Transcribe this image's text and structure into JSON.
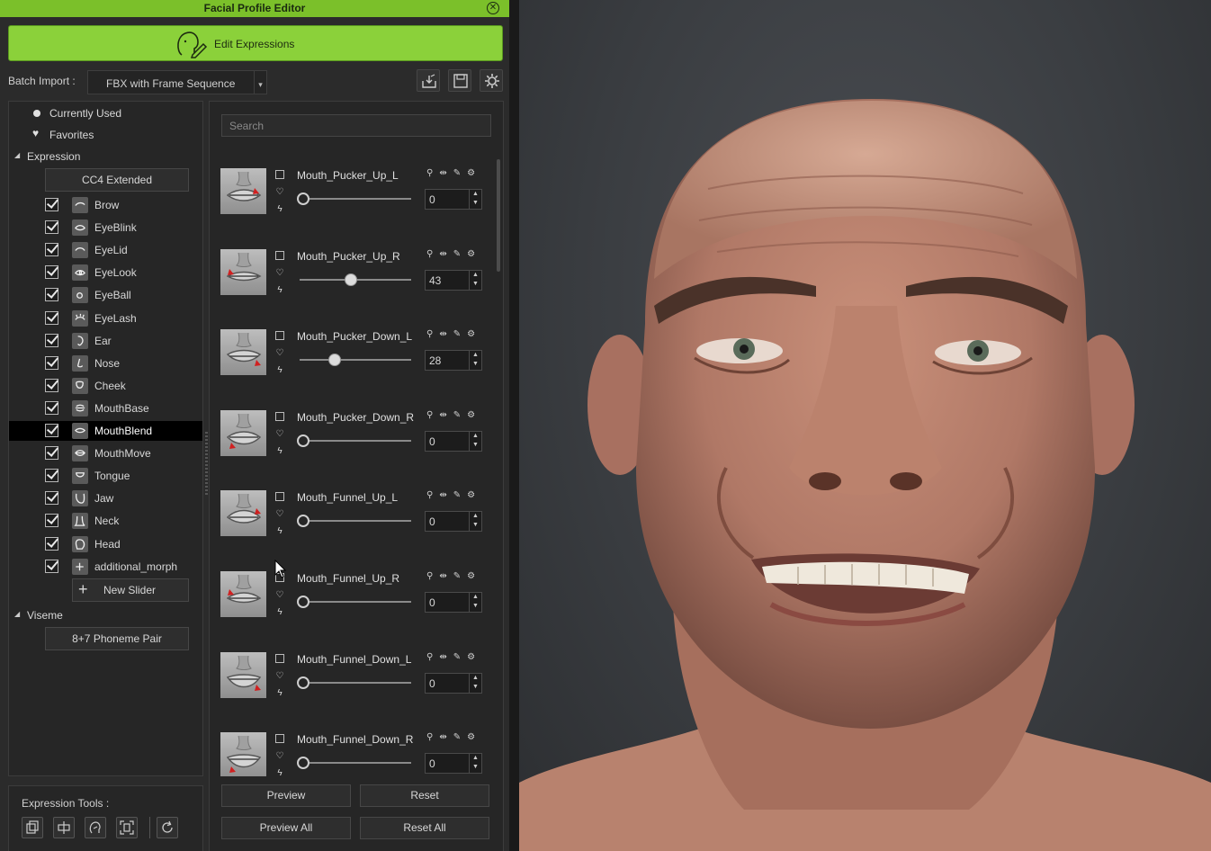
{
  "window": {
    "title": "Facial Profile Editor"
  },
  "edit_expressions": {
    "label": "Edit Expressions"
  },
  "batch_import": {
    "label": "Batch Import :",
    "value": "FBX with Frame Sequence"
  },
  "tree": {
    "currently_used": "Currently Used",
    "favorites": "Favorites",
    "expression_header": "Expression",
    "expression_profile": "CC4 Extended",
    "categories": [
      "Brow",
      "EyeBlink",
      "EyeLid",
      "EyeLook",
      "EyeBall",
      "EyeLash",
      "Ear",
      "Nose",
      "Cheek",
      "MouthBase",
      "MouthBlend",
      "MouthMove",
      "Tongue",
      "Jaw",
      "Neck",
      "Head",
      "additional_morph"
    ],
    "selected_category": "MouthBlend",
    "new_slider": "New Slider",
    "viseme_header": "Viseme",
    "viseme_profile": "8+7 Phoneme Pair"
  },
  "expression_tools": {
    "label": "Expression Tools :"
  },
  "search": {
    "placeholder": "Search"
  },
  "morphs": [
    {
      "name": "Mouth_Pucker_Up_L",
      "value": "0"
    },
    {
      "name": "Mouth_Pucker_Up_R",
      "value": "43"
    },
    {
      "name": "Mouth_Pucker_Down_L",
      "value": "28"
    },
    {
      "name": "Mouth_Pucker_Down_R",
      "value": "0"
    },
    {
      "name": "Mouth_Funnel_Up_L",
      "value": "0"
    },
    {
      "name": "Mouth_Funnel_Up_R",
      "value": "0"
    },
    {
      "name": "Mouth_Funnel_Down_L",
      "value": "0"
    },
    {
      "name": "Mouth_Funnel_Down_R",
      "value": "0"
    }
  ],
  "actions": {
    "preview": "Preview",
    "reset": "Reset",
    "preview_all": "Preview All",
    "reset_all": "Reset All"
  },
  "colors": {
    "accent": "#8bd13a",
    "titlebar": "#7bc02a",
    "panel": "#262626",
    "viewport_bg": "#3a3d41"
  }
}
